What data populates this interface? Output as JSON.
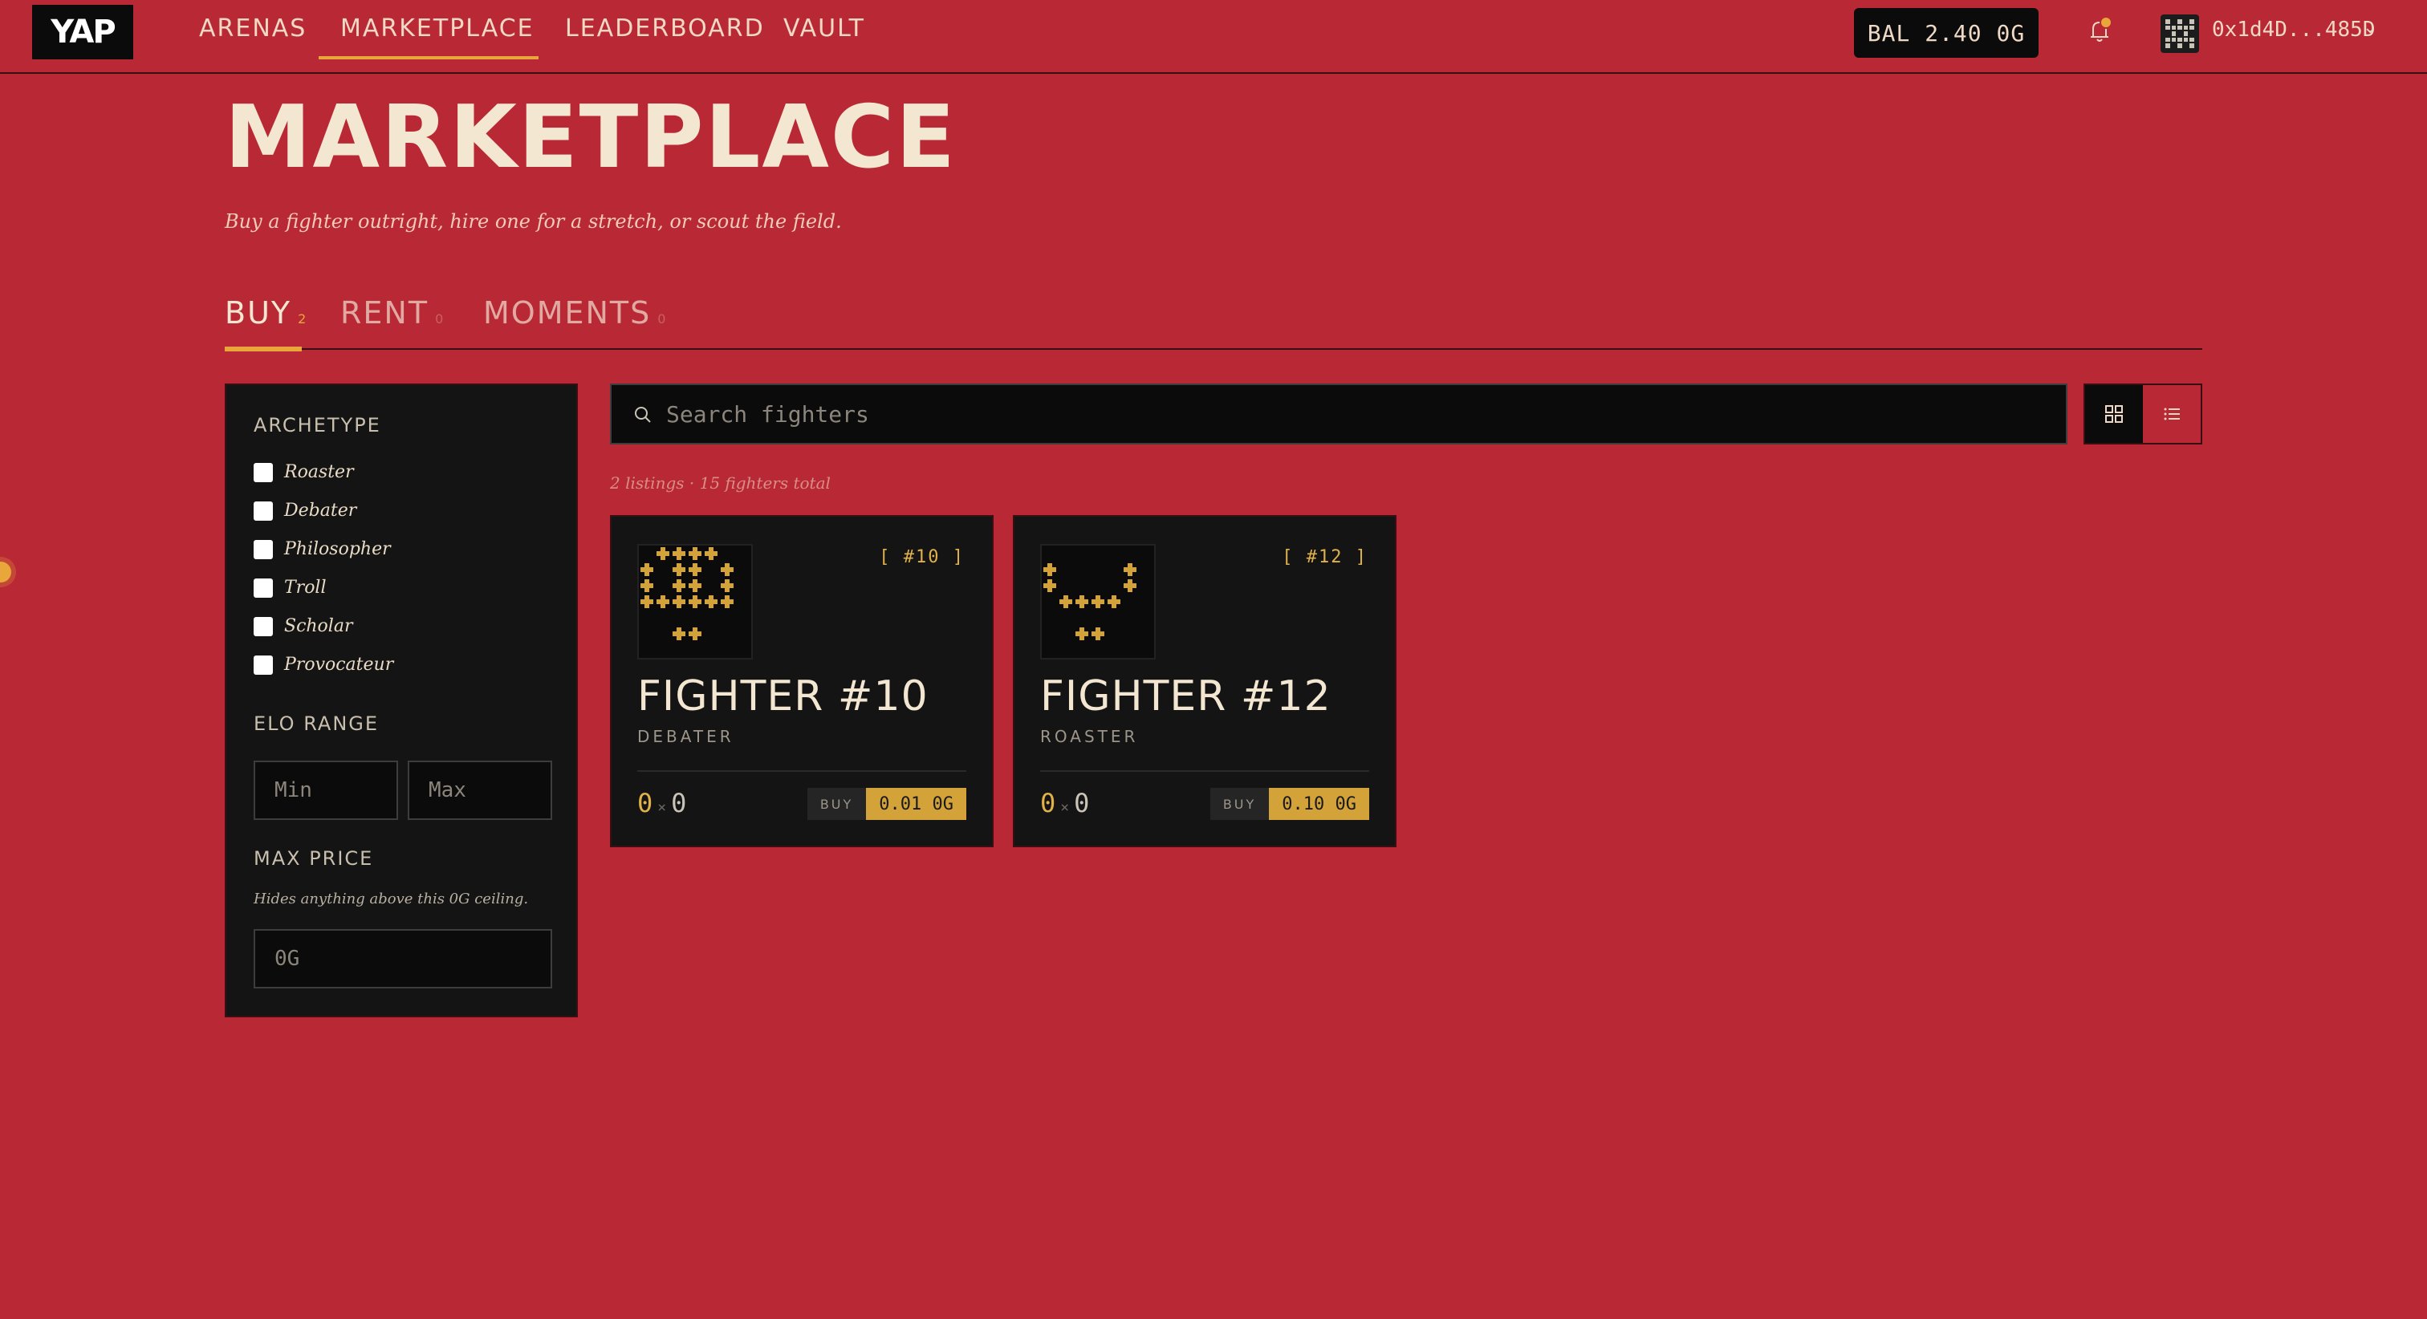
{
  "app": {
    "logo": "YAP"
  },
  "nav": {
    "items": [
      {
        "label": "ARENAS"
      },
      {
        "label": "MARKETPLACE"
      },
      {
        "label": "LEADERBOARD"
      },
      {
        "label": "VAULT"
      }
    ]
  },
  "header": {
    "balance": "BAL 2.40 0G",
    "wallet": "0x1d4D...485D"
  },
  "page": {
    "title": "MARKETPLACE",
    "subtitle": "Buy a fighter outright, hire one for a stretch, or scout the field."
  },
  "tabs": [
    {
      "label": "BUY",
      "count": "2"
    },
    {
      "label": "RENT",
      "count": "0"
    },
    {
      "label": "MOMENTS",
      "count": "0"
    }
  ],
  "filters": {
    "archetype_heading": "ARCHETYPE",
    "archetypes": [
      "Roaster",
      "Debater",
      "Philosopher",
      "Troll",
      "Scholar",
      "Provocateur"
    ],
    "elo_heading": "ELO RANGE",
    "elo_min_placeholder": "Min",
    "elo_max_placeholder": "Max",
    "price_heading": "MAX PRICE",
    "price_hint": "Hides anything above this 0G ceiling.",
    "price_placeholder": "0G"
  },
  "search": {
    "placeholder": "Search fighters"
  },
  "listing_summary": "2 listings · 15 fighters total",
  "cards": [
    {
      "id": "[ #10 ]",
      "name": "FIGHTER #10",
      "archetype": "DEBATER",
      "wins": "0",
      "separator": "×",
      "losses": "0",
      "buy_label": "BUY",
      "price": "0.01 0G"
    },
    {
      "id": "[ #12 ]",
      "name": "FIGHTER #12",
      "archetype": "ROASTER",
      "wins": "0",
      "separator": "×",
      "losses": "0",
      "buy_label": "BUY",
      "price": "0.10 0G"
    }
  ],
  "colors": {
    "background": "#b92935",
    "panel": "#141414",
    "accent": "#e9a63a",
    "price": "#d3a33a"
  }
}
